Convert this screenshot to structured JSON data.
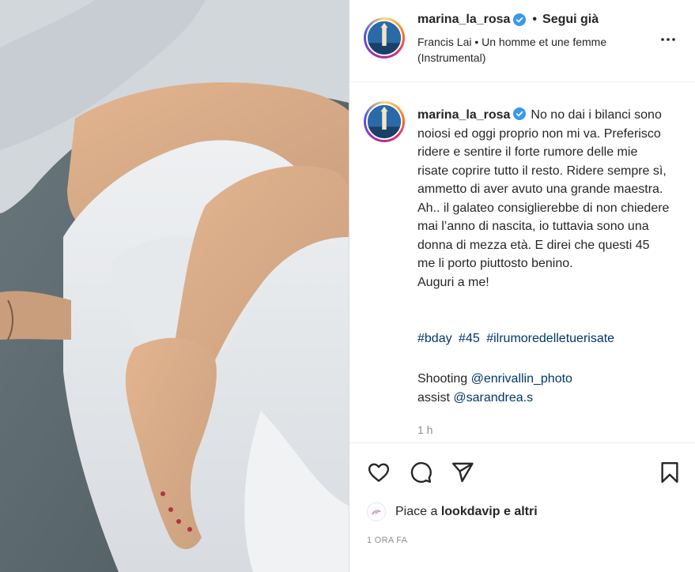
{
  "post": {
    "photo_alt": "",
    "author": {
      "username": "marina_la_rosa",
      "verified": true,
      "follow_state": "Segui già",
      "audio": "Francis Lai • Un homme et une femme (Instrumental)"
    },
    "caption": {
      "username": "marina_la_rosa",
      "text": "No no dai i bilanci sono noiosi ed oggi proprio non mi va. Preferisco ridere e sentire il forte rumore delle mie risate coprire tutto il resto. Ridere sempre sì, ammetto di aver avuto una grande maestra. Ah.. il galateo consiglierebbe di non chiedere mai l’anno di nascita, io tuttavia sono una donna di mezza età. E direi che questi 45 me li porto piuttosto benino.\nAuguri a me!",
      "hashtags": [
        "#bday",
        "#45",
        "#ilrumoredelletuerisate"
      ],
      "shooting_label": "Shooting",
      "shooting_mention": "@enrivallin_photo",
      "assist_label": "assist",
      "assist_mention": "@sarandrea.s",
      "age": "1 h"
    },
    "actions": {
      "like": "heart-icon",
      "comment": "comment-icon",
      "share": "paper-plane-icon",
      "save": "bookmark-icon"
    },
    "likes": {
      "prefix": "Piace a",
      "liker": "lookdavip",
      "suffix": "e altri"
    },
    "timestamp": "1 ORA FA"
  },
  "colors": {
    "verified": "#3897f0",
    "link": "#00376b",
    "muted": "#8e8e8e"
  }
}
